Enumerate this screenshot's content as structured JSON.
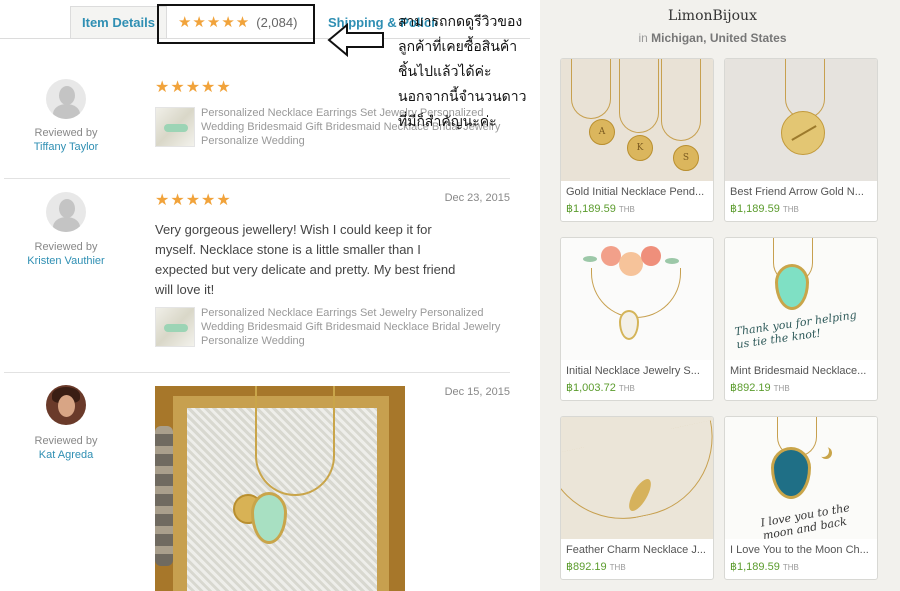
{
  "tabs": {
    "item_details": "Item Details",
    "reviews_stars": "★★★★★",
    "reviews_count": "(2,084)",
    "shipping": "Shipping & Policies"
  },
  "annotation": {
    "lines": [
      "สามารถกดดูรีวิวของ",
      "ลูกค้าที่เคยซื้อสินค้า",
      "ชิ้นไปแล้วได้ค่ะ",
      "นอกจากนี้จำนวนดาว",
      "ที่มีก็สำคัญนะค่ะ"
    ]
  },
  "reviews": [
    {
      "reviewed_by": "Reviewed by",
      "name": "Tiffany Taylor",
      "stars": "★★★★★",
      "date": "",
      "text": "",
      "item_name": "Personalized Necklace Earrings Set Jewelry Personalized Wedding Bridesmaid Gift Bridesmaid Necklace Bridal Jewelry Personalize Wedding"
    },
    {
      "reviewed_by": "Reviewed by",
      "name": "Kristen Vauthier",
      "stars": "★★★★★",
      "date": "Dec 23, 2015",
      "text": "Very gorgeous jewellery! Wish I could keep it for myself. Necklace stone is a little smaller than I expected but very delicate and pretty. My best friend will love it!",
      "item_name": "Personalized Necklace Earrings Set Jewelry Personalized Wedding Bridesmaid Gift Bridesmaid Necklace Bridal Jewelry Personalize Wedding"
    },
    {
      "reviewed_by": "Reviewed by",
      "name": "Kat Agreda",
      "stars": "",
      "date": "Dec 15, 2015",
      "text": "",
      "item_name": ""
    }
  ],
  "shop": {
    "name": "LimonBijoux",
    "location_prefix": "in",
    "location": "Michigan, United States"
  },
  "products": [
    {
      "title": "Gold Initial Necklace Pend...",
      "price": "฿1,189.59",
      "currency": "THB"
    },
    {
      "title": "Best Friend Arrow Gold N...",
      "price": "฿1,189.59",
      "currency": "THB"
    },
    {
      "title": "Initial Necklace Jewelry S...",
      "price": "฿1,003.72",
      "currency": "THB"
    },
    {
      "title": "Mint Bridesmaid Necklace...",
      "price": "฿892.19",
      "currency": "THB"
    },
    {
      "title": "Feather Charm Necklace J...",
      "price": "฿892.19",
      "currency": "THB"
    },
    {
      "title": "I Love You to the Moon Ch...",
      "price": "฿1,189.59",
      "currency": "THB"
    }
  ],
  "product_image_text": {
    "initials": [
      "A",
      "K",
      "S"
    ],
    "mint_card": "Thank you for helping us tie the knot!",
    "moon_card": "I love you to the moon and back"
  },
  "colors": {
    "accent_link": "#2f8fb3",
    "star": "#f1a33b",
    "price": "#5c9c2e"
  }
}
